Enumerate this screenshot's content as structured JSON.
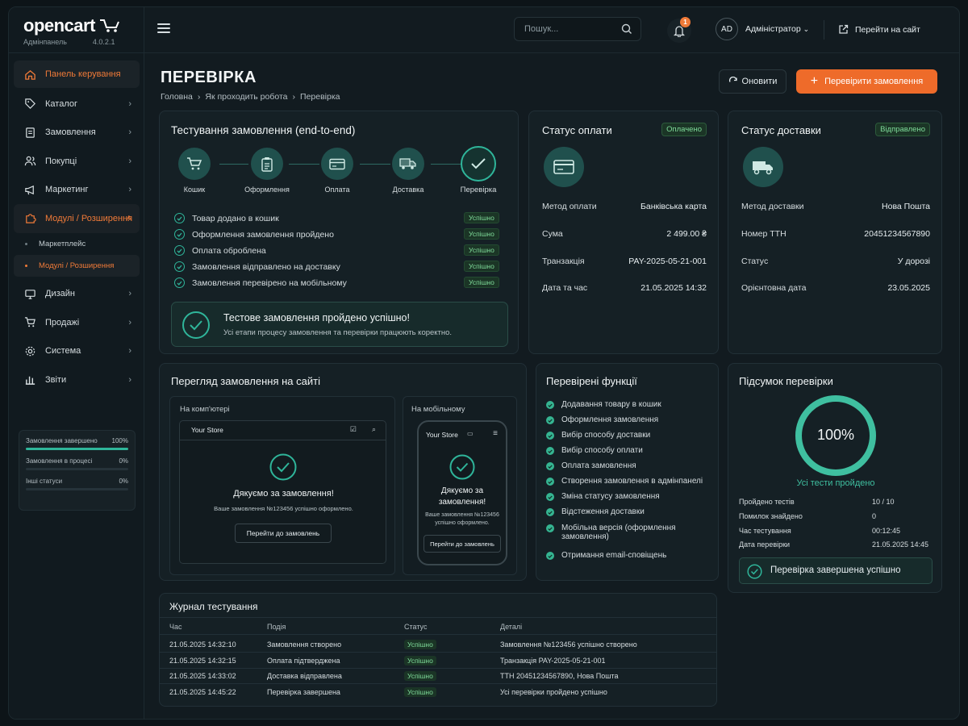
{
  "brand": {
    "logo": "opencart",
    "panel": "Адмінпанель",
    "version": "4.0.2.1"
  },
  "sidebar": {
    "items": [
      {
        "label": "Панель керування",
        "icon": "home-icon"
      },
      {
        "label": "Каталог",
        "icon": "tag-icon"
      },
      {
        "label": "Замовлення",
        "icon": "receipt-icon"
      },
      {
        "label": "Покупці",
        "icon": "users-icon"
      },
      {
        "label": "Маркетинг",
        "icon": "megaphone-icon"
      },
      {
        "label": "Модулі / Розширення",
        "icon": "puzzle-icon"
      },
      {
        "label": "Дизайн",
        "icon": "monitor-icon"
      },
      {
        "label": "Продажі",
        "icon": "cart-icon"
      },
      {
        "label": "Система",
        "icon": "gear-icon"
      },
      {
        "label": "Звіти",
        "icon": "bar-chart-icon"
      }
    ],
    "subitems": [
      {
        "label": "Маркетплейс"
      },
      {
        "label": "Модулі / Розширення"
      }
    ],
    "stats": [
      {
        "label": "Замовлення завершено",
        "value": "100%",
        "fill": 1.0
      },
      {
        "label": "Замовлення в процесі",
        "value": "0%",
        "fill": 0
      },
      {
        "label": "Інші статуси",
        "value": "0%",
        "fill": 0
      }
    ]
  },
  "topbar": {
    "search_placeholder": "Пошук...",
    "notifications": "1",
    "avatar": "AD",
    "user": "Адміністратор",
    "go_site": "Перейти на сайт"
  },
  "page": {
    "title": "ПЕРЕВІРКА",
    "breadcrumbs": [
      "Головна",
      "Як проходить робота",
      "Перевірка"
    ],
    "refresh": "Оновити",
    "check_orders": "Перевірити замовлення"
  },
  "e2e": {
    "title": "Тестування замовлення (end-to-end)",
    "steps": [
      {
        "label": "Кошик"
      },
      {
        "label": "Оформлення"
      },
      {
        "label": "Оплата"
      },
      {
        "label": "Доставка"
      },
      {
        "label": "Перевірка"
      }
    ],
    "checks": [
      {
        "label": "Товар додано в кошик",
        "status": "Успішно"
      },
      {
        "label": "Оформлення замовлення пройдено",
        "status": "Успішно"
      },
      {
        "label": "Оплата оброблена",
        "status": "Успішно"
      },
      {
        "label": "Замовлення відправлено на доставку",
        "status": "Успішно"
      },
      {
        "label": "Замовлення перевірено на мобільному",
        "status": "Успішно"
      }
    ],
    "result_title": "Тестове замовлення пройдено успішно!",
    "result_text": "Усі етапи процесу замовлення та перевірки працюють коректно."
  },
  "payment": {
    "title": "Статус оплати",
    "status": "Оплачено",
    "rows": [
      {
        "k": "Метод оплати",
        "v": "Банківська карта"
      },
      {
        "k": "Сума",
        "v": "2 499.00 ₴"
      },
      {
        "k": "Транзакція",
        "v": "PAY-2025-05-21-001"
      },
      {
        "k": "Дата та час",
        "v": "21.05.2025 14:32"
      }
    ]
  },
  "delivery": {
    "title": "Статус доставки",
    "status": "Відправлено",
    "rows": [
      {
        "k": "Метод доставки",
        "v": "Нова Пошта"
      },
      {
        "k": "Номер ТТН",
        "v": "20451234567890"
      },
      {
        "k": "Статус",
        "v": "У дорозі"
      },
      {
        "k": "Орієнтовна дата",
        "v": "23.05.2025"
      }
    ]
  },
  "preview": {
    "title": "Перегляд замовлення на сайті",
    "desktop_label": "На комп'ютері",
    "mobile_label": "На мобільному",
    "store": "Your Store",
    "thanks": "Дякуємо за замовлення!",
    "desktop_msg": "Ваше замовлення №123456 успішно оформлено.",
    "mobile_msg_1": "Ваше замовлення №123456",
    "mobile_msg_2": "успішно оформлено.",
    "btn": "Перейти до замовлень",
    "mobile_thanks_1": "Дякуємо за",
    "mobile_thanks_2": "замовлення!"
  },
  "features": {
    "title": "Перевірені функції",
    "items": [
      {
        "label": "Додавання товару в кошик"
      },
      {
        "label": "Оформлення замовлення"
      },
      {
        "label": "Вибір способу доставки"
      },
      {
        "label": "Вибір способу оплати"
      },
      {
        "label": "Оплата замовлення"
      },
      {
        "label": "Створення замовлення в адмінпанелі"
      },
      {
        "label": "Зміна статусу замовлення"
      },
      {
        "label": "Відстеження доставки"
      },
      {
        "label": "Мобільна версія (оформлення замовлення)"
      },
      {
        "label": "Отримання email-сповіщень"
      }
    ]
  },
  "summary": {
    "title": "Підсумок перевірки",
    "percent": "100%",
    "progress": 1.0,
    "caption": "Усі тести пройдено",
    "rows": [
      {
        "k": "Пройдено тестів",
        "v": "10 / 10"
      },
      {
        "k": "Помилок знайдено",
        "v": "0"
      },
      {
        "k": "Час тестування",
        "v": "00:12:45"
      },
      {
        "k": "Дата перевірки",
        "v": "21.05.2025 14:45"
      }
    ],
    "done": "Перевірка завершена успішно"
  },
  "log": {
    "title": "Журнал тестування",
    "headers": [
      "Час",
      "Подія",
      "Статус",
      "Деталі"
    ],
    "rows": [
      {
        "time": "21.05.2025 14:32:10",
        "event": "Замовлення створено",
        "status": "Успішно",
        "details": "Замовлення №123456 успішно створено"
      },
      {
        "time": "21.05.2025 14:32:15",
        "event": "Оплата підтверджена",
        "status": "Успішно",
        "details": "Транзакція PAY-2025-05-21-001"
      },
      {
        "time": "21.05.2025 14:33:02",
        "event": "Доставка відправлена",
        "status": "Успішно",
        "details": "ТТН 20451234567890, Нова Пошта"
      },
      {
        "time": "21.05.2025 14:45:22",
        "event": "Перевірка завершена",
        "status": "Успішно",
        "details": "Усі перевірки пройдено успішно"
      }
    ]
  },
  "colors": {
    "accent": "#ee6b2a",
    "teal": "#2fb59a",
    "success": "#7fdc9a"
  }
}
